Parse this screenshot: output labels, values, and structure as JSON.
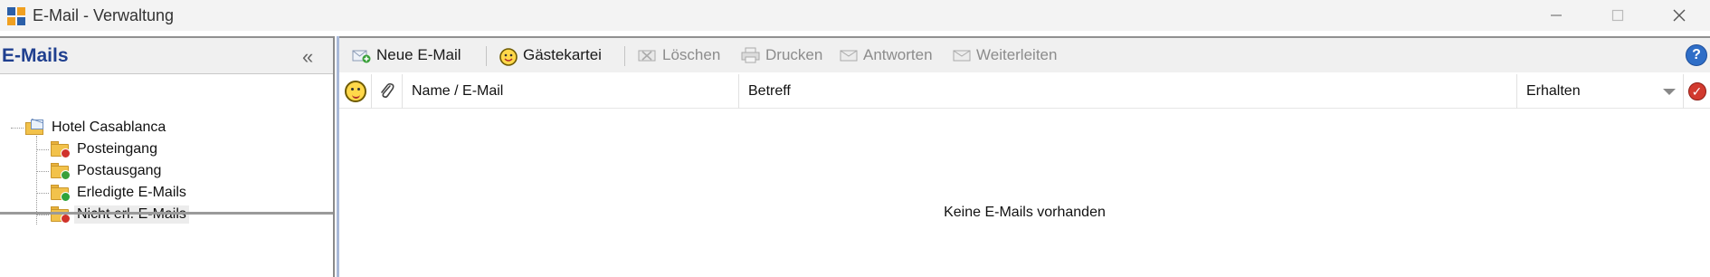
{
  "window": {
    "title": "E-Mail - Verwaltung",
    "minimize_icon": "minimize-icon",
    "maximize_icon": "maximize-icon",
    "close_icon": "close-icon"
  },
  "sidebar": {
    "header": "E-Mails",
    "collapse_glyph": "«",
    "tree": {
      "root": {
        "label": "Hotel Casablanca",
        "icon": "mailbox-folder-icon"
      },
      "items": [
        {
          "label": "Posteingang",
          "icon": "inbox-folder-icon",
          "badge_color": "#d0322a"
        },
        {
          "label": "Postausgang",
          "icon": "outbox-folder-icon",
          "badge_color": "#3aa03a"
        },
        {
          "label": "Erledigte E-Mails",
          "icon": "done-folder-icon",
          "badge_color": "#2fa33a"
        },
        {
          "label": "Nicht erl. E-Mails",
          "icon": "undone-folder-icon",
          "badge_color": "#d0322a",
          "selected": true
        }
      ]
    }
  },
  "toolbar": {
    "new_email": "Neue E-Mail",
    "guest_file": "Gästekartei",
    "delete": "Löschen",
    "print": "Drucken",
    "reply": "Antworten",
    "forward": "Weiterleiten",
    "help_glyph": "?"
  },
  "grid": {
    "columns": {
      "name": "Name / E-Mail",
      "subject": "Betreff",
      "received": "Erhalten"
    },
    "empty_message": "Keine E-Mails vorhanden"
  },
  "colors": {
    "sidebar_header_text": "#1f3f8f",
    "accent_border": "#a9b9d8",
    "help_button": "#2f6ec7"
  }
}
